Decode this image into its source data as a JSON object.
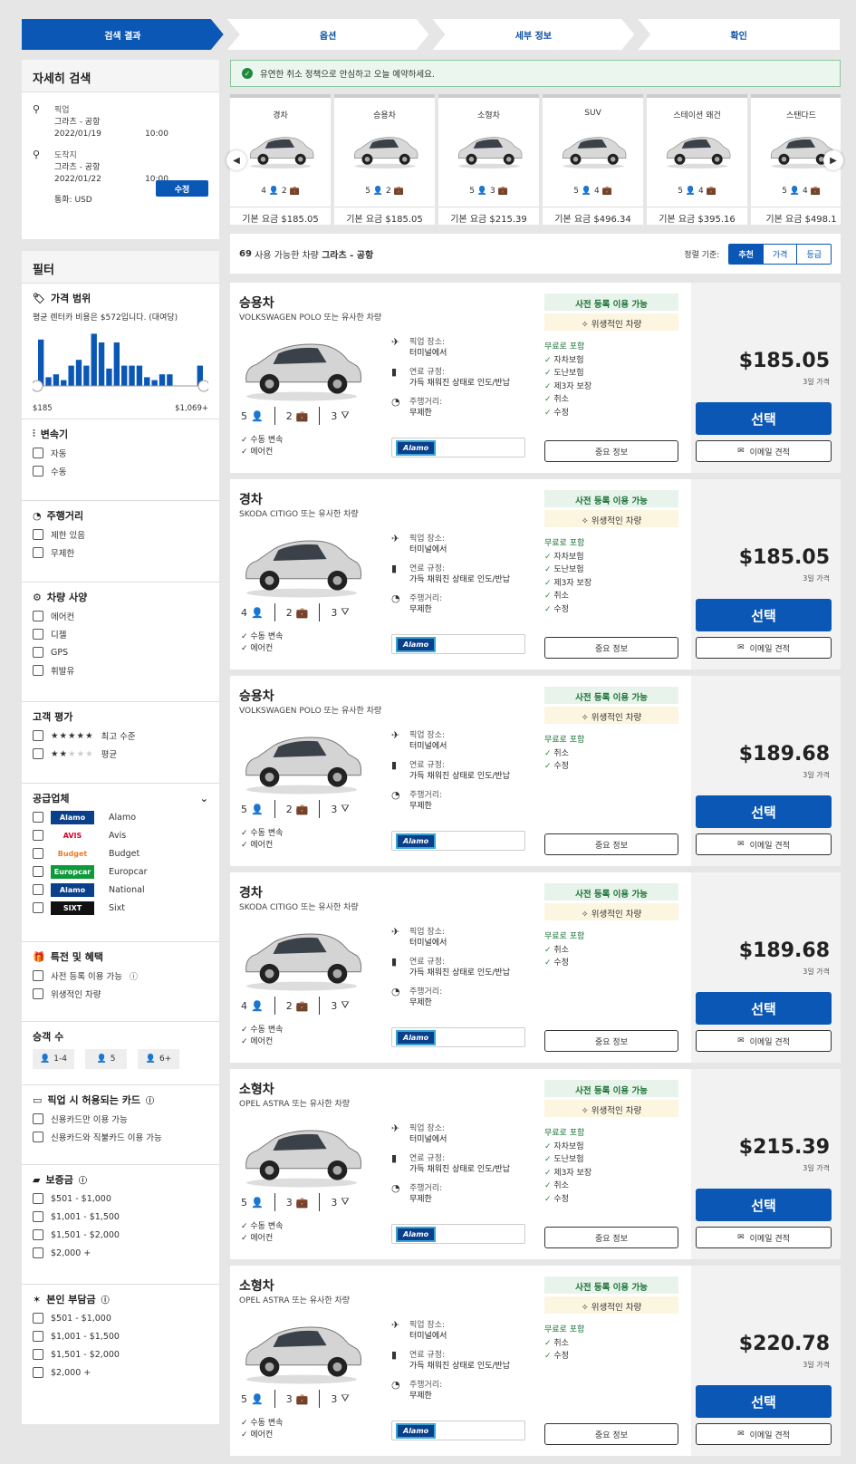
{
  "steps": [
    "검색 결과",
    "옵션",
    "세부 정보",
    "확인"
  ],
  "banner": "유연한 취소 정책으로 안심하고 오늘 예약하세요.",
  "search": {
    "title": "자세히 검색",
    "pickup_label": "픽업",
    "pickup_loc": "그라츠 - 공항",
    "pickup_date": "2022/01/19",
    "pickup_time": "10:00",
    "dropoff_label": "도착지",
    "dropoff_loc": "그라츠 - 공항",
    "dropoff_date": "2022/01/22",
    "dropoff_time": "10:00",
    "currency": "통화: USD",
    "edit": "수정"
  },
  "filter": {
    "title": "필터",
    "price": {
      "title": "가격 범위",
      "note": "평균 렌터카 비용은 $572입니다. (대여당)",
      "min": "$185",
      "max": "$1,069+",
      "histogram": [
        0.8,
        0.15,
        0.2,
        0.1,
        0.35,
        0.45,
        0.35,
        0.9,
        0.75,
        0.3,
        0.75,
        0.35,
        0.35,
        0.35,
        0.15,
        0.1,
        0.2,
        0.2,
        0,
        0,
        0,
        0.35
      ]
    },
    "transmission": {
      "title": "변속기",
      "options": [
        "자동",
        "수동"
      ]
    },
    "mileage": {
      "title": "주행거리",
      "options": [
        "제한 있음",
        "무제한"
      ]
    },
    "features": {
      "title": "차량 사양",
      "options": [
        "에어컨",
        "디젤",
        "GPS",
        "휘발유"
      ]
    },
    "rating": {
      "title": "고객 평가",
      "options": [
        "최고 수준",
        "평균"
      ]
    },
    "suppliers": {
      "title": "공급업체",
      "items": [
        {
          "logo": "Alamo",
          "name": "Alamo",
          "color": "#0a3f8a"
        },
        {
          "logo": "AVIS",
          "name": "Avis",
          "color": "#d4002a"
        },
        {
          "logo": "Budget",
          "name": "Budget",
          "color": "#f47c20"
        },
        {
          "logo": "Europcar",
          "name": "Europcar",
          "color": "#0f9a3a"
        },
        {
          "logo": "Alamo",
          "name": "National",
          "color": "#0a3f8a"
        },
        {
          "logo": "SIXT",
          "name": "Sixt",
          "color": "#111"
        }
      ]
    },
    "deals": {
      "title": "특전 및 혜택",
      "options": [
        "사전 등록 이용 가능",
        "위생적인 차량"
      ]
    },
    "passengers": {
      "title": "승객 수",
      "options": [
        "1-4",
        "5",
        "6+"
      ]
    },
    "cards": {
      "title": "픽업 시 허용되는 카드",
      "options": [
        "신용카드만 이용 가능",
        "신용카드와 직불카드 이용 가능"
      ]
    },
    "deposit": {
      "title": "보증금",
      "options": [
        "$501 - $1,000",
        "$1,001 - $1,500",
        "$1,501 - $2,000",
        "$2,000 +"
      ]
    },
    "excess": {
      "title": "본인 부담금",
      "options": [
        "$501 - $1,000",
        "$1,001 - $1,500",
        "$1,501 - $2,000",
        "$2,000 +"
      ]
    }
  },
  "categories": [
    {
      "name": "경차",
      "seats": "4",
      "bags": "2",
      "price": "기본 요금 $185.05"
    },
    {
      "name": "승용차",
      "seats": "5",
      "bags": "2",
      "price": "기본 요금 $185.05"
    },
    {
      "name": "소형차",
      "seats": "5",
      "bags": "3",
      "price": "기본 요금 $215.39"
    },
    {
      "name": "SUV",
      "seats": "5",
      "bags": "4",
      "price": "기본 요금 $496.34"
    },
    {
      "name": "스테이션 왜건",
      "seats": "5",
      "bags": "4",
      "price": "기본 요금 $395.16"
    },
    {
      "name": "스탠다드",
      "seats": "5",
      "bags": "4",
      "price": "기본 요금 $498.1"
    }
  ],
  "results": {
    "count": "69",
    "text": "사용 가능한 차량",
    "location": "그라츠 - 공항",
    "sort_label": "정렬 기준:",
    "sort_opts": [
      "추천",
      "가격",
      "등급"
    ]
  },
  "common": {
    "prereg": "사전 등록 이용 가능",
    "hygiene": "위생적인 차량",
    "included": "무료로 포함",
    "pickup_lab": "픽업 장소:",
    "pickup_val": "터미널에서",
    "fuel_lab": "연료 규정:",
    "fuel_val": "가득 채워진 상태로 인도/반납",
    "mile_lab": "주행거리:",
    "mile_val": "무제한",
    "important": "중요 정보",
    "select": "선택",
    "email": "이메일 견적",
    "days": "3일 가격",
    "manual": "수동 변속",
    "ac": "에어컨",
    "supplier": "Alamo"
  },
  "cards": [
    {
      "cls": "승용차",
      "sim": "VOLKSWAGEN POLO 또는 유사한 차량",
      "seats": "5",
      "bags": "2",
      "doors": "3",
      "price": "$185.05",
      "incl": [
        "자차보험",
        "도난보험",
        "제3자 보장",
        "취소",
        "수정"
      ]
    },
    {
      "cls": "경차",
      "sim": "SKODA CITIGO 또는 유사한 차량",
      "seats": "4",
      "bags": "2",
      "doors": "3",
      "price": "$185.05",
      "incl": [
        "자차보험",
        "도난보험",
        "제3자 보장",
        "취소",
        "수정"
      ]
    },
    {
      "cls": "승용차",
      "sim": "VOLKSWAGEN POLO 또는 유사한 차량",
      "seats": "5",
      "bags": "2",
      "doors": "3",
      "price": "$189.68",
      "incl": [
        "취소",
        "수정"
      ]
    },
    {
      "cls": "경차",
      "sim": "SKODA CITIGO 또는 유사한 차량",
      "seats": "4",
      "bags": "2",
      "doors": "3",
      "price": "$189.68",
      "incl": [
        "취소",
        "수정"
      ]
    },
    {
      "cls": "소형차",
      "sim": "OPEL ASTRA 또는 유사한 차량",
      "seats": "5",
      "bags": "3",
      "doors": "3",
      "price": "$215.39",
      "incl": [
        "자차보험",
        "도난보험",
        "제3자 보장",
        "취소",
        "수정"
      ]
    },
    {
      "cls": "소형차",
      "sim": "OPEL ASTRA 또는 유사한 차량",
      "seats": "5",
      "bags": "3",
      "doors": "3",
      "price": "$220.78",
      "incl": [
        "취소",
        "수정"
      ]
    }
  ]
}
